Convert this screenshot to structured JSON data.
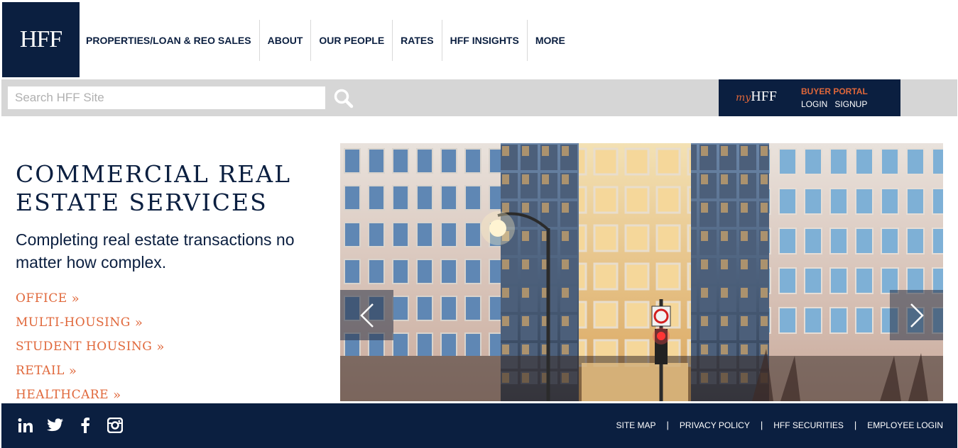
{
  "brand": {
    "logo_text": "HFF",
    "color_navy": "#0b1f40",
    "color_orange": "#e0673a"
  },
  "nav": {
    "items": [
      {
        "label": "PROPERTIES/LOAN & REO SALES"
      },
      {
        "label": "ABOUT"
      },
      {
        "label": "OUR PEOPLE"
      },
      {
        "label": "RATES"
      },
      {
        "label": "HFF INSIGHTS"
      },
      {
        "label": "MORE"
      }
    ]
  },
  "search": {
    "placeholder": "Search HFF Site",
    "icon": "search-icon"
  },
  "portal": {
    "my": "my",
    "hff": "HFF",
    "title": "BUYER PORTAL",
    "login": "LOGIN",
    "signup": "SIGNUP"
  },
  "main": {
    "headline": "COMMERCIAL REAL ESTATE SERVICES",
    "subhead": "Completing real estate transactions no matter how complex.",
    "categories": [
      {
        "label": "OFFICE"
      },
      {
        "label": "MULTI-HOUSING"
      },
      {
        "label": "STUDENT HOUSING"
      },
      {
        "label": "RETAIL"
      },
      {
        "label": "HEALTHCARE"
      }
    ]
  },
  "hero": {
    "prev_icon": "chevron-left-icon",
    "next_icon": "chevron-right-icon"
  },
  "footer": {
    "social": [
      "linkedin-icon",
      "twitter-icon",
      "facebook-icon",
      "instagram-icon"
    ],
    "links": [
      {
        "label": "SITE MAP"
      },
      {
        "label": "PRIVACY POLICY"
      },
      {
        "label": "HFF SECURITIES"
      },
      {
        "label": "EMPLOYEE LOGIN"
      }
    ]
  }
}
